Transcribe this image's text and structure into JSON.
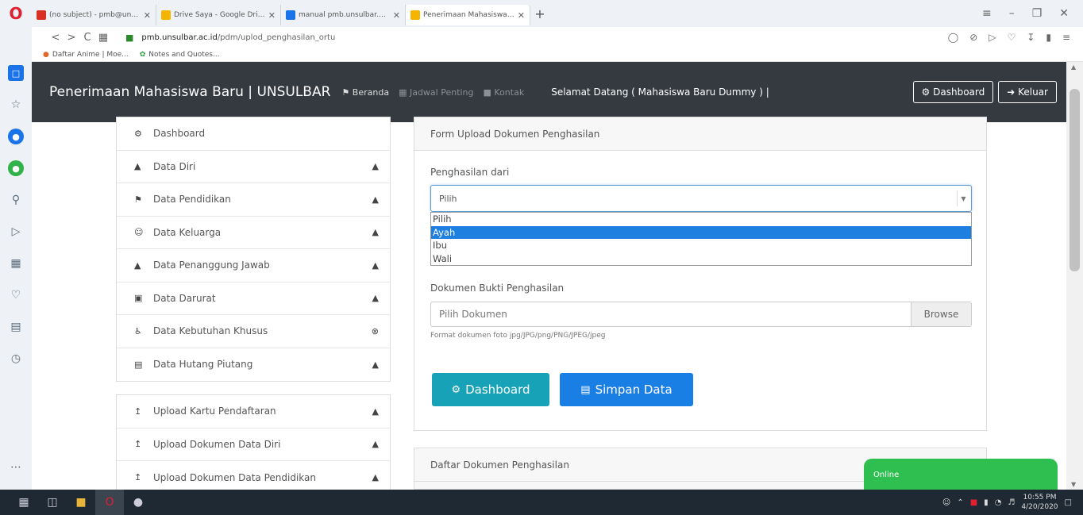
{
  "browser": {
    "tabs": [
      {
        "label": "(no subject) - pmb@unsul",
        "color": "#d93025",
        "active": false
      },
      {
        "label": "Drive Saya - Google Drive",
        "color": "#f4b400",
        "active": false
      },
      {
        "label": "manual pmb.unsulbar.ac.i",
        "color": "#1a73e8",
        "active": false
      },
      {
        "label": "Penerimaan Mahasiswa Ba",
        "color": "#f4b400",
        "active": true
      }
    ],
    "url_host": "pmb.unsulbar.ac.id",
    "url_path": "/pdm/uplod_penghasilan_ortu",
    "bookmarks": [
      "Daftar Anime | Moe...",
      "Notes and Quotes..."
    ]
  },
  "header": {
    "brand": "Penerimaan Mahasiswa Baru | UNSULBAR",
    "nav": [
      "Beranda",
      "Jadwal Penting",
      "Kontak"
    ],
    "welcome": "Selamat Datang ( Mahasiswa Baru Dummy ) |",
    "dashboard_btn": "Dashboard",
    "logout_btn": "Keluar"
  },
  "menu1": [
    {
      "label": "Dashboard",
      "icon": "⚙",
      "state": ""
    },
    {
      "label": "Data Diri",
      "icon": "▲",
      "state": "▲"
    },
    {
      "label": "Data Pendidikan",
      "icon": "⚑",
      "state": "▲"
    },
    {
      "label": "Data Keluarga",
      "icon": "☺",
      "state": "▲"
    },
    {
      "label": "Data Penanggung Jawab",
      "icon": "▲",
      "state": "▲"
    },
    {
      "label": "Data Darurat",
      "icon": "▣",
      "state": "▲"
    },
    {
      "label": "Data Kebutuhan Khusus",
      "icon": "♿",
      "state": "⊗"
    },
    {
      "label": "Data Hutang Piutang",
      "icon": "▤",
      "state": "▲"
    }
  ],
  "menu2": [
    {
      "label": "Upload Kartu Pendaftaran",
      "icon": "↥",
      "state": "▲"
    },
    {
      "label": "Upload Dokumen Data Diri",
      "icon": "↥",
      "state": "▲"
    },
    {
      "label": "Upload Dokumen Data Pendidikan",
      "icon": "↥",
      "state": "▲"
    }
  ],
  "form": {
    "title": "Form Upload Dokumen Penghasilan",
    "income_label": "Penghasilan dari",
    "income_value": "Pilih",
    "options": [
      "Pilih",
      "Ayah",
      "Ibu",
      "Wali"
    ],
    "highlighted_option": "Ayah",
    "doc_label": "Dokumen Bukti Penghasilan",
    "file_placeholder": "Pilih Dokumen",
    "browse": "Browse",
    "help": "Format dokumen foto jpg/JPG/png/PNG/JPEG/jpeg",
    "btn_dashboard": "Dashboard",
    "btn_save": "Simpan Data"
  },
  "list_panel": {
    "title": "Daftar Dokumen Penghasilan"
  },
  "chat": {
    "status": "Online"
  },
  "taskbar": {
    "time": "10:55 PM",
    "date": "4/20/2020"
  }
}
